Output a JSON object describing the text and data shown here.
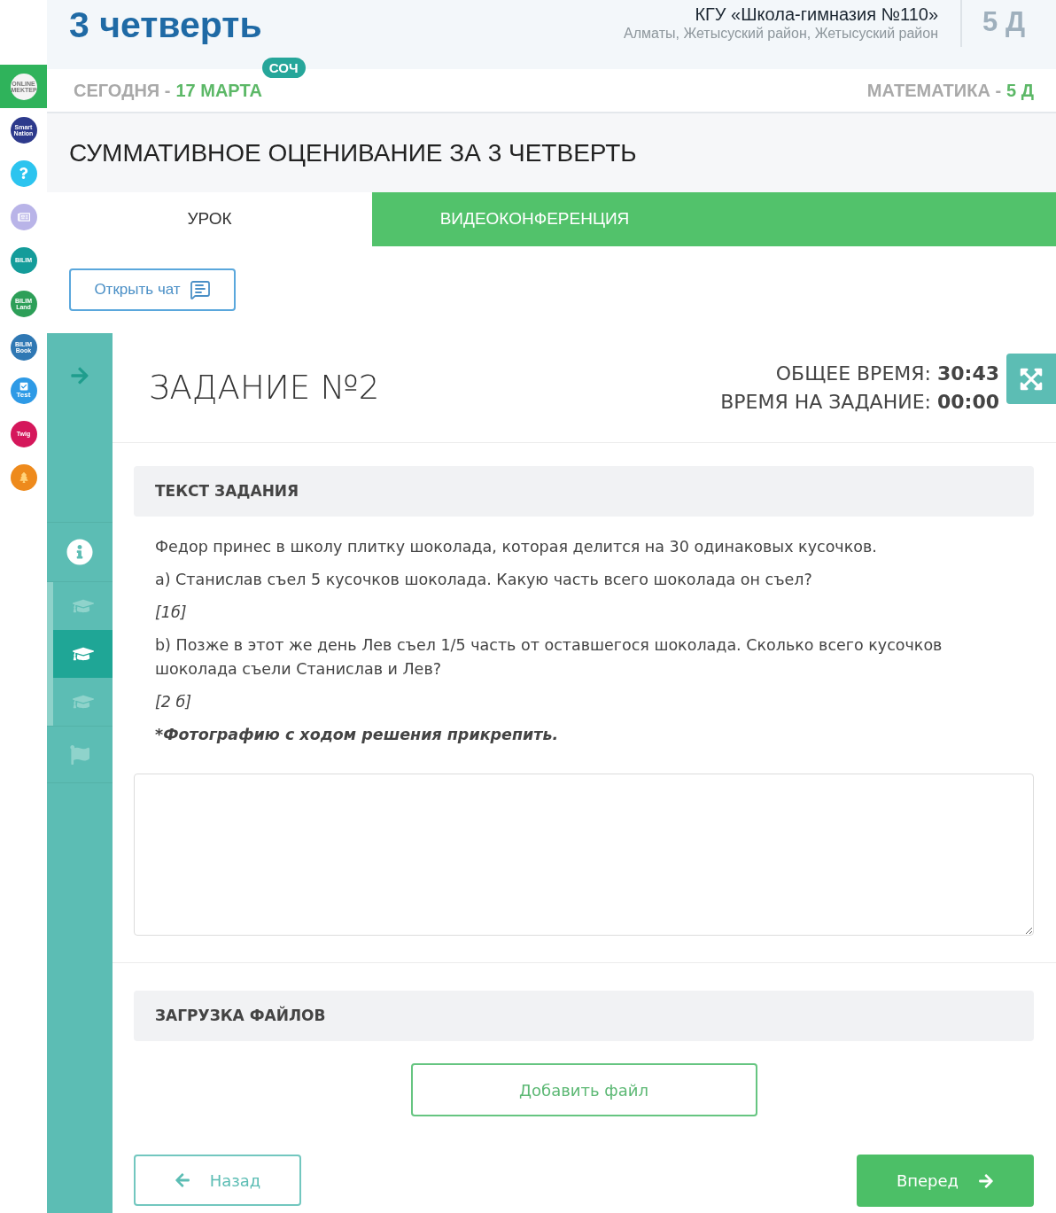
{
  "app_rail": {
    "items": [
      {
        "kind": "light",
        "label": "ONLINE MEKTEP",
        "color": "#f4f4f4",
        "selected": true
      },
      {
        "kind": "text",
        "label": "Smart Nation",
        "color": "#2d3a8c",
        "selected": false
      },
      {
        "kind": "help",
        "color": "#2cc4ef",
        "selected": false
      },
      {
        "kind": "news",
        "color": "#b9b4e8",
        "selected": false
      },
      {
        "kind": "text",
        "label": "BILIM",
        "color": "#149c9a",
        "selected": false
      },
      {
        "kind": "text",
        "label": "BILIM Land",
        "color": "#2d9f58",
        "selected": false
      },
      {
        "kind": "text",
        "label": "BILIM Book",
        "color": "#2f78b4",
        "selected": false
      },
      {
        "kind": "test",
        "label": "Test",
        "color": "#2e9ae6",
        "selected": false
      },
      {
        "kind": "text",
        "label": "Twig",
        "color": "#d5175b",
        "selected": false
      },
      {
        "kind": "tree",
        "color": "#ee8a1c",
        "selected": false
      }
    ]
  },
  "header": {
    "quarter_title": "3 четверть",
    "school_name": "КГУ «Школа-гимназия №110»",
    "school_address": "Алматы, Жетысуский район, Жетысуский район",
    "class_name": "5 Д"
  },
  "date_bar": {
    "today_label": "СЕГОДНЯ -",
    "date": "17 МАРТА",
    "badge": "СОЧ",
    "subject": "МАТЕМАТИКА -",
    "class_name": "5 Д"
  },
  "page_title": "СУММАТИВНОЕ ОЦЕНИВАНИЕ ЗА 3 ЧЕТВЕРТЬ",
  "tabs": [
    {
      "label": "УРОК",
      "selected": true
    },
    {
      "label": "ВИДЕОКОНФЕРЕНЦИЯ",
      "selected": false
    }
  ],
  "chat_button": "Открыть чат",
  "task_nav": {
    "items": [
      {
        "kind": "info",
        "selected": false
      },
      {
        "kind": "task",
        "selected": false
      },
      {
        "kind": "task",
        "selected": true
      },
      {
        "kind": "task",
        "selected": false
      },
      {
        "kind": "finish",
        "selected": false
      }
    ]
  },
  "task": {
    "title": "ЗАДАНИЕ №2",
    "timers": [
      "ОБЩЕЕ ВРЕМЯ: **30:43**",
      "ВРЕМЯ НА ЗАДАНИЕ: **00:00**"
    ],
    "text_section": {
      "heading": "ТЕКСТ ЗАДАНИЯ",
      "paragraphs": [
        {
          "kind": "plain",
          "text": "Федор принес в школу плитку шоколада, которая делится на 30 одинаковых кусочков."
        },
        {
          "kind": "plain",
          "text": "a) Станислав съел 5 кусочков шоколада. Какую часть всего шоколада он съел?"
        },
        {
          "kind": "italic",
          "text": "[1б]"
        },
        {
          "kind": "plain",
          "text": "b) Позже в этот же день Лев съел 1/5 часть от оставшегося шоколада. Сколько всего кусочков шоколада съели Станислав и Лев?"
        },
        {
          "kind": "italic",
          "text": "[2 б]"
        },
        {
          "kind": "bold_italic",
          "text": "*Фотографию с ходом решения прикрепить."
        }
      ]
    },
    "upload_section": {
      "heading": "ЗАГРУЗКА ФАЙЛОВ",
      "add_button": "Добавить файл"
    },
    "nav_buttons": {
      "back": "Назад",
      "next": "Вперед"
    }
  }
}
